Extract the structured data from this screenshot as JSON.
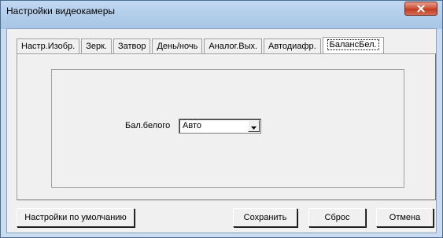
{
  "window": {
    "title": "Настройки видеокамеры",
    "close_icon": "close-icon"
  },
  "tabs": [
    {
      "label": "Настр.Изобр.",
      "active": false
    },
    {
      "label": "Зерк.",
      "active": false
    },
    {
      "label": "Затвор",
      "active": false
    },
    {
      "label": "День/ночь",
      "active": false
    },
    {
      "label": "Аналог.Вых.",
      "active": false
    },
    {
      "label": "Автодиафр.",
      "active": false
    },
    {
      "label": "БалансБел.",
      "active": true
    }
  ],
  "white_balance": {
    "label": "Бал.белого",
    "value": "Авто",
    "dropdown_icon": "chevron-down-icon"
  },
  "buttons": {
    "defaults": "Настройки по умолчанию",
    "save": "Сохранить",
    "reset": "Сброс",
    "cancel": "Отмена"
  },
  "colors": {
    "titlebar": "#b5cfec",
    "close_button": "#c13b21",
    "dialog_face": "#f0f0f0"
  }
}
